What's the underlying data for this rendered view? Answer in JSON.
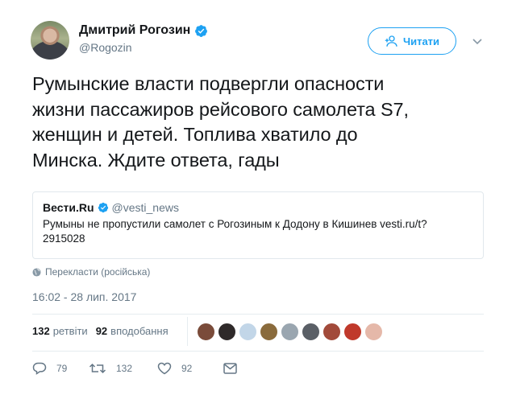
{
  "author": {
    "name": "Дмитрий Рогозин",
    "handle": "@Rogozin",
    "verified": true
  },
  "follow_button": {
    "label": "Читати",
    "icon": "add-user-icon",
    "color": "#1da1f2"
  },
  "menu_icon": "chevron-down-icon",
  "tweet": {
    "text_lines": [
      "Румынские власти подвергли опасности",
      "жизни пассажиров рейсового самолета S7,",
      "женщин и детей. Топлива хватило до",
      "Минска. Ждите ответа, гады"
    ]
  },
  "quoted_tweet": {
    "name": "Вести.Ru",
    "handle": "@vesti_news",
    "verified": true,
    "text": "Румыны не пропустили самолет с Рогозиным к Додону в Кишинев vesti.ru/t?2915028"
  },
  "translate": {
    "label": "Перекласти (російська)",
    "icon": "globe-icon"
  },
  "timestamp": "16:02 - 28 лип. 2017",
  "stats": {
    "retweets_count": "132",
    "retweets_label": "ретвіти",
    "likes_count": "92",
    "likes_label": "вподобання"
  },
  "likers": [
    {
      "color": "#7a4b3a"
    },
    {
      "color": "#2f2a2a"
    },
    {
      "color": "#c2d6e8"
    },
    {
      "color": "#8a6b3c"
    },
    {
      "color": "#9aa6b0"
    },
    {
      "color": "#5a5f66"
    },
    {
      "color": "#a24a3a"
    },
    {
      "color": "#c0392b"
    },
    {
      "color": "#e5b8a9"
    }
  ],
  "actions": {
    "reply_count": "79",
    "retweet_count": "132",
    "like_count": "92"
  }
}
